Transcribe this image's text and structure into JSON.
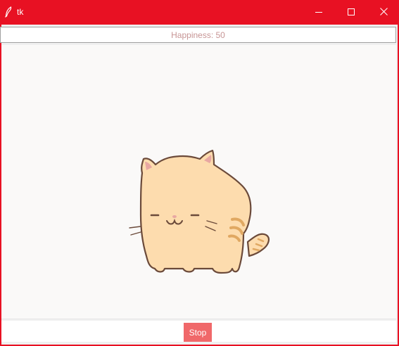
{
  "window": {
    "title": "tk",
    "accent_color": "#e81123",
    "icons": {
      "app": "feather-icon",
      "minimize": "minimize-icon",
      "maximize": "maximize-icon",
      "close": "close-icon"
    }
  },
  "status": {
    "happiness_text": "Happiness: 50",
    "happiness_value": 50,
    "text_color": "#c79595"
  },
  "pet": {
    "image": "cat-illustration",
    "colors": {
      "body": "#fddcae",
      "outline": "#6b4a3a",
      "stripes": "#e0a862",
      "ear_inner": "#e8a7a2"
    }
  },
  "controls": {
    "stop_label": "Stop",
    "stop_color": "#f0686a"
  }
}
